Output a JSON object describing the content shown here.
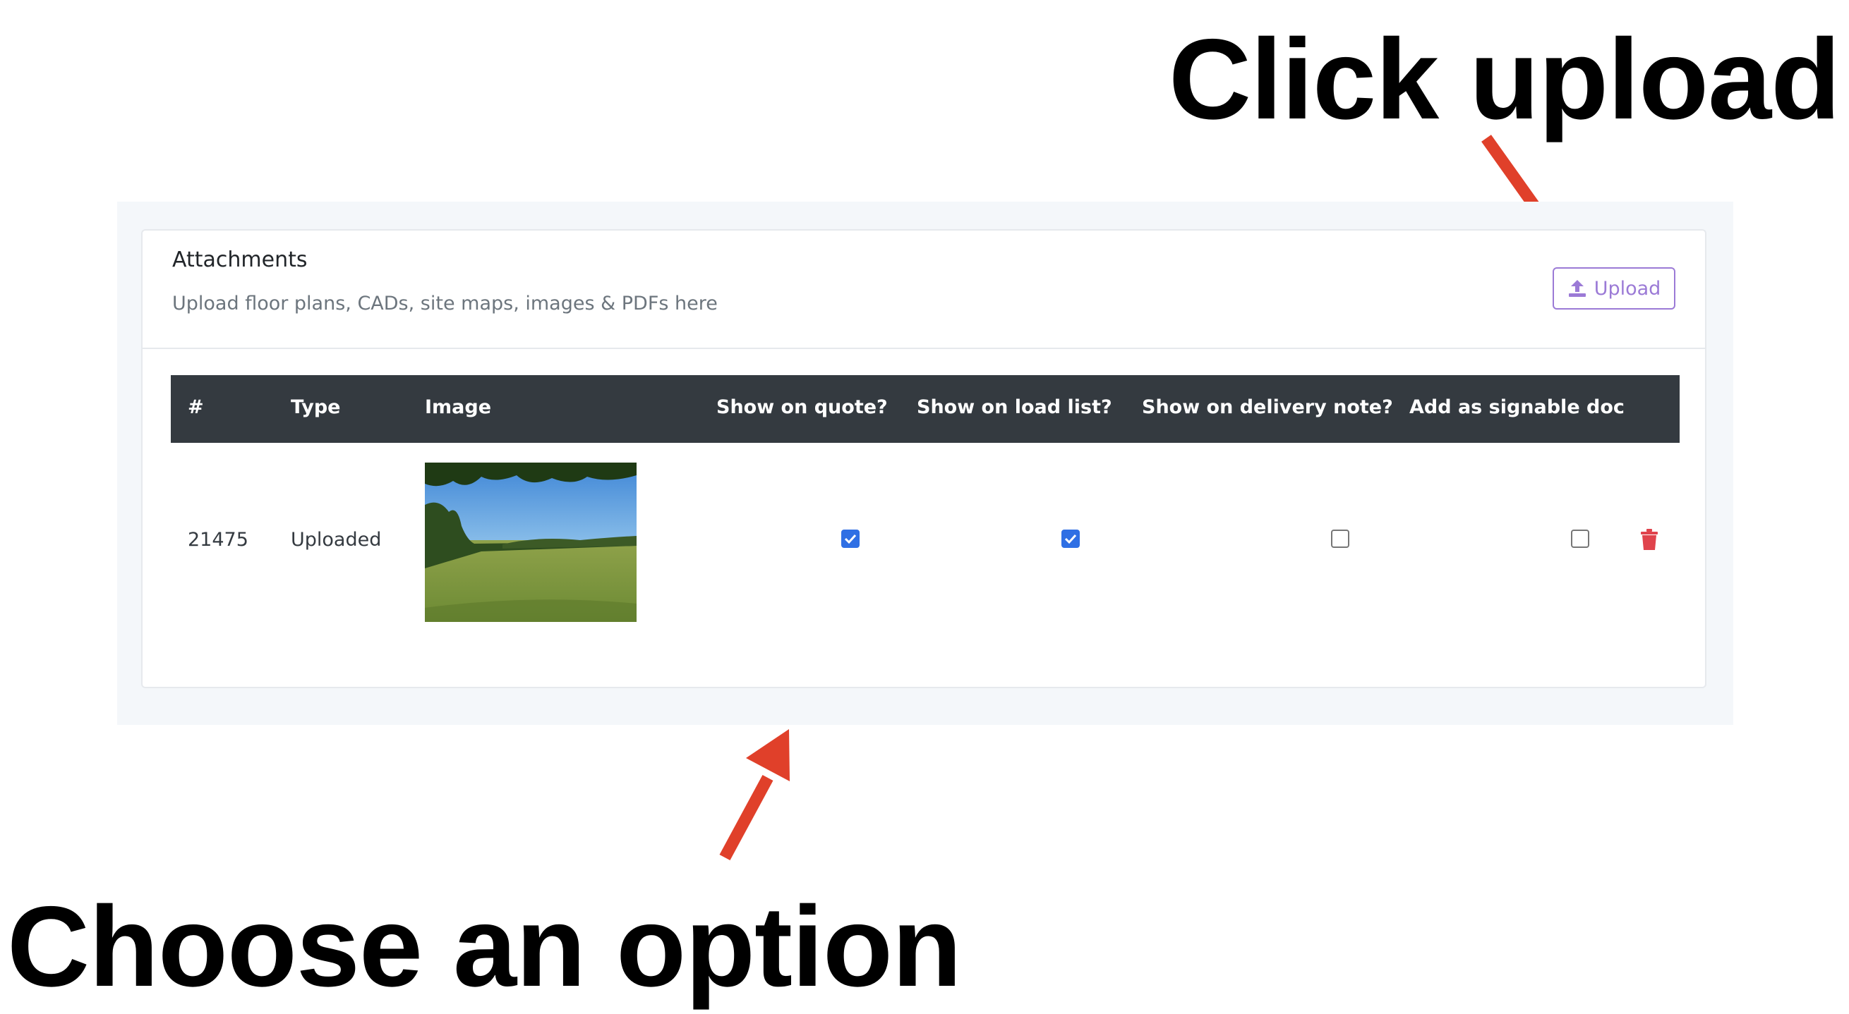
{
  "annotations": {
    "top_callout": "Click upload",
    "bottom_callout": "Choose an option",
    "arrow_color": "#e0402a"
  },
  "card": {
    "title": "Attachments",
    "subtitle": "Upload floor plans, CADs, site maps, images & PDFs here",
    "upload_label": "Upload",
    "upload_icon": "upload-icon",
    "accent_color": "#9b7ad6"
  },
  "table": {
    "headers": [
      "#",
      "Type",
      "Image",
      "Show on quote?",
      "Show on load list?",
      "Show on delivery note?",
      "Add as signable doc"
    ],
    "rows": [
      {
        "id": "21475",
        "type": "Uploaded",
        "image": "field-photo",
        "show_on_quote": true,
        "show_on_load_list": true,
        "show_on_delivery_note": false,
        "add_as_signable_doc": false,
        "delete_icon": "trash-icon"
      }
    ],
    "header_bg": "#343a40",
    "checkbox_color": "#2f6fe4",
    "delete_color": "#e0434c"
  }
}
